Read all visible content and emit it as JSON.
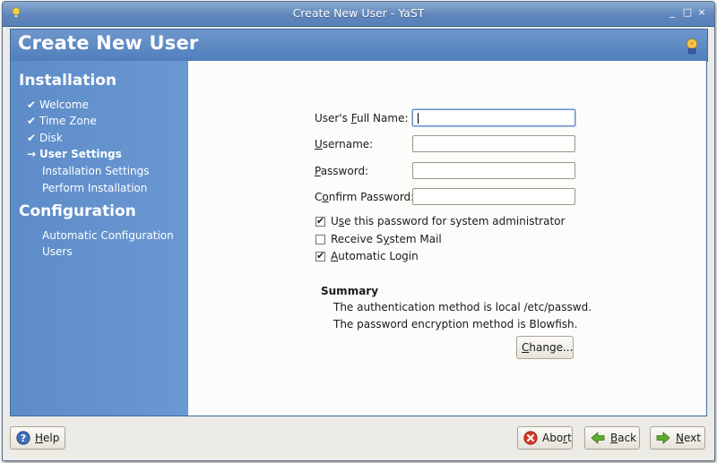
{
  "window": {
    "title": "Create New User - YaST",
    "minimize_glyph": "_",
    "maximize_glyph": "□",
    "close_glyph": "×"
  },
  "header": {
    "title": "Create New User",
    "icon": "lightbulb-user-icon"
  },
  "sidebar": {
    "installation_heading": "Installation",
    "installation_items": [
      {
        "label": "Welcome",
        "status": "done",
        "mark": "✔"
      },
      {
        "label": "Time Zone",
        "status": "done",
        "mark": "✔"
      },
      {
        "label": "Disk",
        "status": "done",
        "mark": "✔"
      },
      {
        "label": "User Settings",
        "status": "current",
        "mark": "→"
      },
      {
        "label": "Installation Settings",
        "status": "pending",
        "mark": ""
      },
      {
        "label": "Perform Installation",
        "status": "pending",
        "mark": ""
      }
    ],
    "configuration_heading": "Configuration",
    "configuration_items": [
      {
        "label": "Automatic Configuration"
      },
      {
        "label": "Users"
      }
    ]
  },
  "form": {
    "full_name": {
      "label_pre": "User's ",
      "label_mn": "F",
      "label_post": "ull Name:",
      "value": ""
    },
    "username": {
      "label_pre": "",
      "label_mn": "U",
      "label_post": "sername:",
      "value": ""
    },
    "password": {
      "label_pre": "",
      "label_mn": "P",
      "label_post": "assword:",
      "value": ""
    },
    "confirm_password": {
      "label_pre": "C",
      "label_mn": "o",
      "label_post": "nfirm Password:",
      "value": ""
    },
    "checkboxes": [
      {
        "label_pre": "U",
        "label_mn": "s",
        "label_post": "e this password for system administrator",
        "checked": true
      },
      {
        "label_pre": "Receive S",
        "label_mn": "y",
        "label_post": "stem Mail",
        "checked": false
      },
      {
        "label_pre": "",
        "label_mn": "A",
        "label_post": "utomatic Login",
        "checked": true
      }
    ]
  },
  "summary": {
    "title": "Summary",
    "line1": "The authentication method is local /etc/passwd.",
    "line2": "The password encryption method is Blowfish.",
    "change_pre": "",
    "change_mn": "C",
    "change_post": "hange..."
  },
  "footer": {
    "help": {
      "pre": "",
      "mn": "H",
      "post": "elp"
    },
    "abort": {
      "pre": "Abo",
      "mn": "r",
      "post": "t"
    },
    "back": {
      "pre": "",
      "mn": "B",
      "post": "ack"
    },
    "next": {
      "pre": "",
      "mn": "N",
      "post": "ext"
    }
  },
  "colors": {
    "header_blue": "#5680b8",
    "sidebar_blue": "#6a98d3",
    "content_bg": "#fcfcfb",
    "abort_red": "#d23c2a",
    "arrow_green": "#5fae2e"
  }
}
